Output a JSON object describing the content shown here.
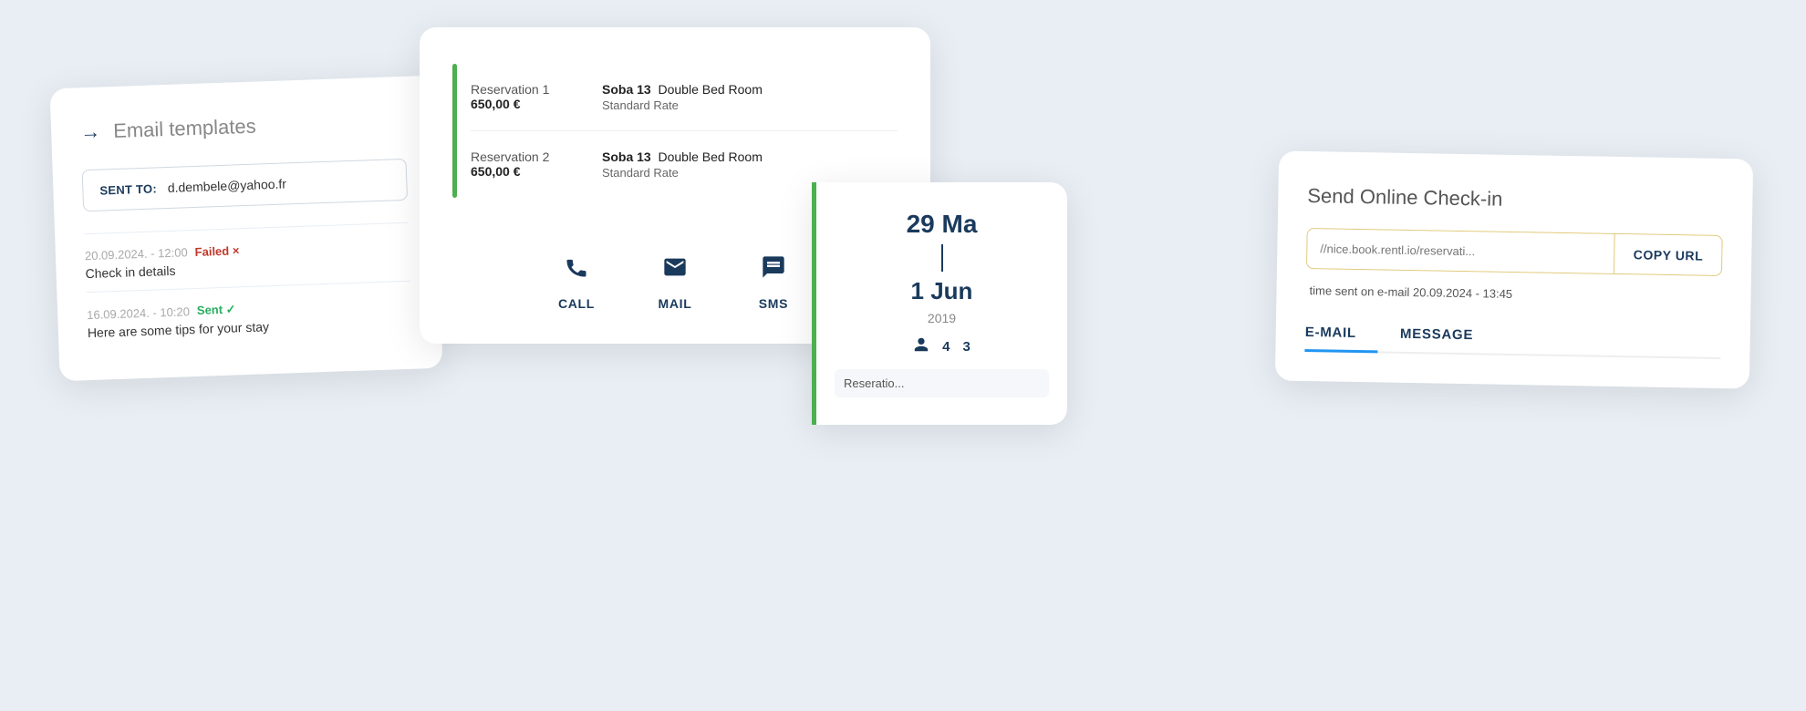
{
  "email_card": {
    "title": "Email templates",
    "arrow": "→",
    "sent_to_label": "SENT TO:",
    "sent_to_email": "d.dembele@yahoo.fr",
    "logs": [
      {
        "date": "20.09.2024. - 12:00",
        "status": "Failed ×",
        "status_type": "failed",
        "description": "Check in details"
      },
      {
        "date": "16.09.2024. - 10:20",
        "status": "Sent ✓",
        "status_type": "sent",
        "description": "Here are some tips for your stay"
      }
    ]
  },
  "reservations_card": {
    "reservations": [
      {
        "label": "Reservation 1",
        "price": "650,00 €",
        "room_bold": "Soba 13",
        "room": "Double Bed Room",
        "rate": "Standard Rate"
      },
      {
        "label": "Reservation 2",
        "price": "650,00 €",
        "room_bold": "Soba 13",
        "room": "Double Bed Room",
        "rate": "Standard Rate"
      }
    ],
    "actions": [
      {
        "icon": "📞",
        "label": "CALL"
      },
      {
        "icon": "✉",
        "label": "MAIL"
      },
      {
        "icon": "💬",
        "label": "SMS"
      }
    ]
  },
  "calendar_card": {
    "date_start": "29 Ma",
    "date_end": "1 Jun",
    "year": "2019",
    "persons": "4",
    "reservations_count": "3",
    "res_label": "Reseratio..."
  },
  "checkin_card": {
    "title": "Send Online Check-in",
    "url_placeholder": "//nice.book.rentl.io/reservati...",
    "copy_url_label": "COPY URL",
    "sent_info": "time sent on e-mail 20.09.2024 - 13:45",
    "tabs": [
      {
        "label": "E-MAIL",
        "active": true
      },
      {
        "label": "MESSAGE",
        "active": false
      }
    ]
  }
}
